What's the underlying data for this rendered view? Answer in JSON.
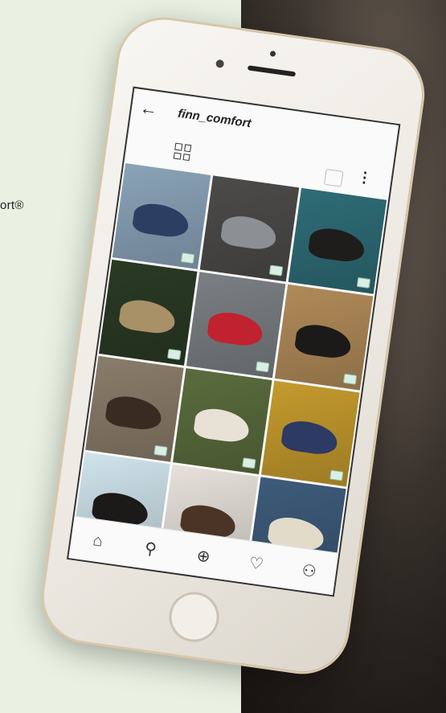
{
  "page": {
    "brand_fragment": "ort®"
  },
  "profile": {
    "username": "finn_comfort"
  },
  "icons": {
    "back": "back-arrow-icon",
    "grid": "grid-view-icon",
    "more": "more-options-icon",
    "tagged": "tagged-photos-icon",
    "home": "home-icon",
    "search": "search-icon",
    "add": "add-post-icon",
    "activity": "heart-icon",
    "profile": "profile-icon"
  },
  "glyphs": {
    "back": "←",
    "more": "⋮",
    "home": "⌂",
    "search": "⚲",
    "add": "⊕",
    "activity": "♡",
    "profile": "⚇"
  },
  "colors": {
    "background_left": "#e8f1e2",
    "phone_body": "#f2efe9",
    "phone_rim": "#d8c7a9"
  },
  "posts": [
    {
      "bg": "#8aa3b8",
      "shoe": "#2d3e63"
    },
    {
      "bg": "#4c4b49",
      "shoe": "#8c8f93"
    },
    {
      "bg": "#2e6c76",
      "shoe": "#1f1d1c"
    },
    {
      "bg": "#2a3a24",
      "shoe": "#a89067"
    },
    {
      "bg": "#7a7f83",
      "shoe": "#c0222f"
    },
    {
      "bg": "#b08a58",
      "shoe": "#1b1a19"
    },
    {
      "bg": "#8a7c6a",
      "shoe": "#3a2b22"
    },
    {
      "bg": "#5a6c3d",
      "shoe": "#e8e2d6"
    },
    {
      "bg": "#c49a2d",
      "shoe": "#2d3a63"
    },
    {
      "bg": "#cfe3ea",
      "shoe": "#1c1a19"
    },
    {
      "bg": "#e6e1da",
      "shoe": "#4b3426"
    },
    {
      "bg": "#3d5b7a",
      "shoe": "#e2dbc9"
    }
  ]
}
